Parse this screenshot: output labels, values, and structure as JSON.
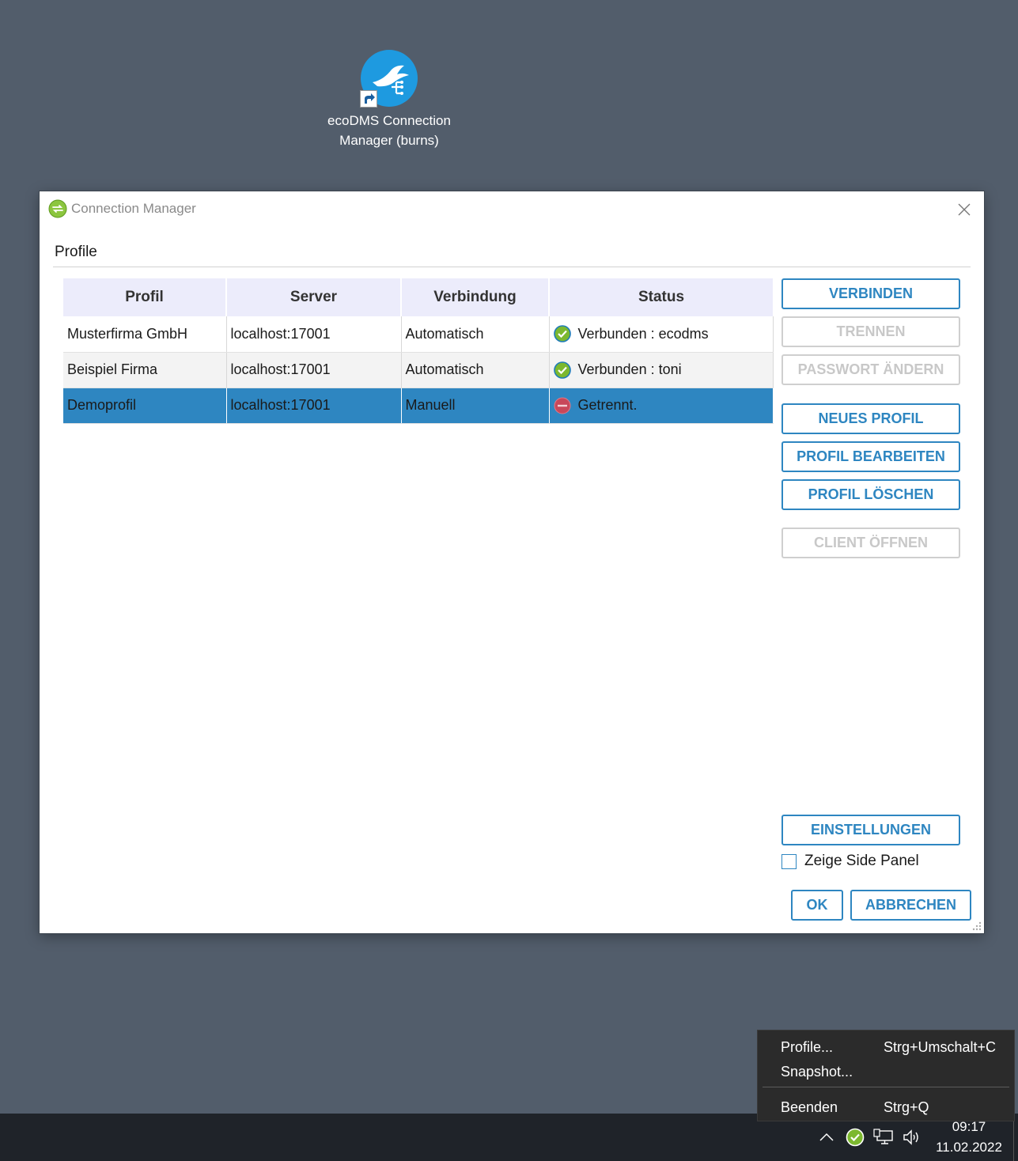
{
  "desktop": {
    "shortcut_label": "ecoDMS Connection Manager (burns)"
  },
  "dialog": {
    "title": "Connection Manager",
    "section_label": "Profile",
    "table": {
      "headers": [
        "Profil",
        "Server",
        "Verbindung",
        "Status"
      ],
      "rows": [
        {
          "profil": "Musterfirma GmbH",
          "server": "localhost:17001",
          "verbindung": "Automatisch",
          "status": "Verbunden : ecodms",
          "state": "connected"
        },
        {
          "profil": "Beispiel Firma",
          "server": "localhost:17001",
          "verbindung": "Automatisch",
          "status": "Verbunden : toni",
          "state": "connected"
        },
        {
          "profil": "Demoprofil",
          "server": "localhost:17001",
          "verbindung": "Manuell",
          "status": "Getrennt.",
          "state": "disconnected",
          "selected": true
        }
      ]
    },
    "buttons": {
      "verbinden": "VERBINDEN",
      "trennen": "TRENNEN",
      "passwort_aendern": "PASSWORT ÄNDERN",
      "neues_profil": "NEUES PROFIL",
      "profil_bearbeiten": "PROFIL BEARBEITEN",
      "profil_loeschen": "PROFIL LÖSCHEN",
      "client_oeffnen": "CLIENT ÖFFNEN",
      "einstellungen": "EINSTELLUNGEN",
      "ok": "OK",
      "abbrechen": "ABBRECHEN"
    },
    "side_panel_checkbox": {
      "label": "Zeige Side Panel",
      "checked": false
    }
  },
  "context_menu": {
    "items": [
      {
        "label": "Profile...",
        "shortcut": "Strg+Umschalt+C"
      },
      {
        "label": "Snapshot...",
        "shortcut": ""
      },
      {
        "label": "Beenden",
        "shortcut": "Strg+Q"
      }
    ]
  },
  "taskbar": {
    "time": "09:17",
    "date": "11.02.2022"
  },
  "colors": {
    "accent": "#2e86c1",
    "desktop": "#525d6b",
    "header_bg": "#ececfb",
    "connected": "#7cb82f",
    "disconnected": "#c8485a"
  }
}
